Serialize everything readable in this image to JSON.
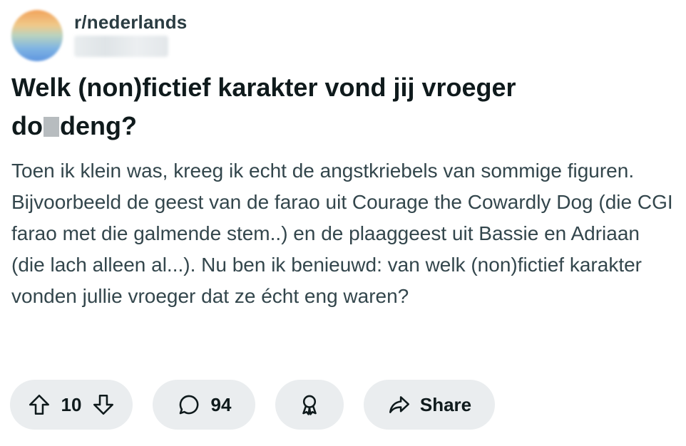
{
  "post": {
    "subreddit": "r/nederlands",
    "title_part1": "Welk (non)fictief karakter vond jij vroeger",
    "title_part2_start": "do",
    "title_part2_end": "deng?",
    "body": "Toen ik klein was, kreeg ik echt de angstkriebels van sommige figuren. Bijvoorbeeld de geest van de farao uit Courage the Cowardly Dog (die CGI farao met die galmende stem..) en de plaaggeest uit Bassie en Adriaan (die lach alleen al...). Nu ben ik benieuwd: van welk (non)fictief karakter vonden jullie vroeger dat ze écht eng waren?"
  },
  "actions": {
    "vote_count": "10",
    "comment_count": "94",
    "share_label": "Share"
  },
  "colors": {
    "pill_bg": "#eaedef",
    "text_primary": "#0f1a1c",
    "text_body": "#33464c"
  },
  "icons": [
    "upvote-icon",
    "downvote-icon",
    "comment-icon",
    "award-icon",
    "share-icon"
  ]
}
